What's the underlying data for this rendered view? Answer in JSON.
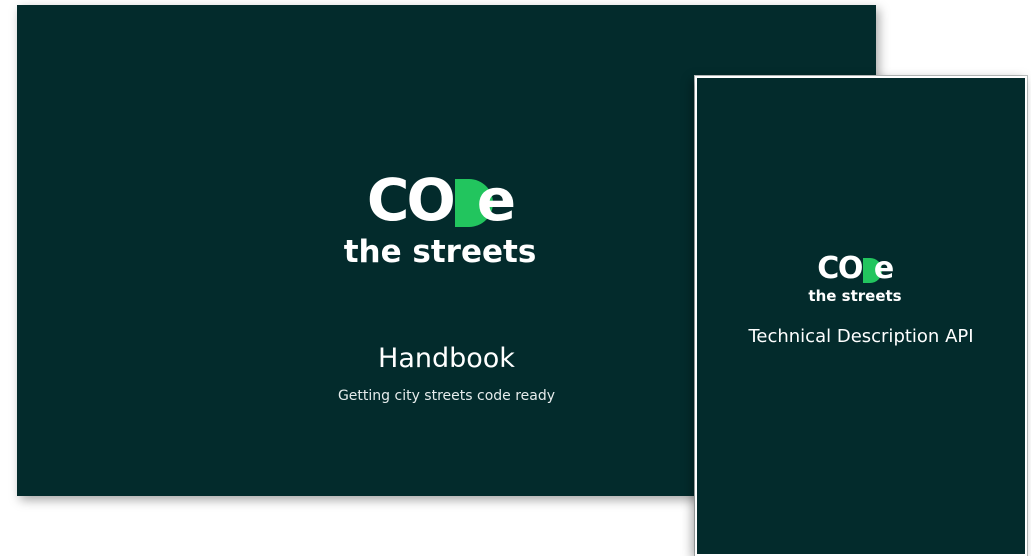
{
  "colors": {
    "background": "#032b2c",
    "accent": "#22c55e",
    "text": "#ffffff"
  },
  "handbook": {
    "logo": {
      "word_prefix": "CO",
      "word_d": "D",
      "word_e": "e",
      "tagline": "the streets"
    },
    "title": "Handbook",
    "subtitle": "Getting city streets code ready"
  },
  "api_doc": {
    "logo": {
      "word_prefix": "CO",
      "word_d": "D",
      "word_e": "e",
      "tagline": "the streets"
    },
    "title": "Technical Description API"
  }
}
